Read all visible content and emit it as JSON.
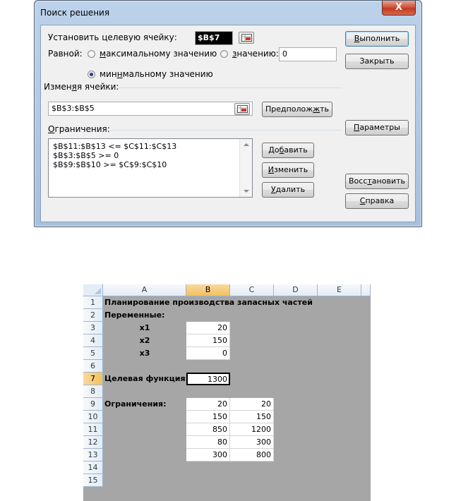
{
  "dialog": {
    "title": "Поиск решения",
    "close_glyph": "X",
    "target_label": "Установить целевую ячейку:",
    "target_value": "$B$7",
    "equal_label": "Равной:",
    "radio_max": "максимальному значению",
    "radio_value": "значению:",
    "value_input": "0",
    "radio_min": "минимальному значению",
    "changing_label": "Изменяя ячейки:",
    "changing_value": "$B$3:$B$5",
    "guess_button": "Предположить",
    "constraints_label": "Ограничения:",
    "constraints": [
      "$B$11:$B$13 <= $C$11:$C$13",
      "$B$3:$B$5 >= 0",
      "$B$9:$B$10 >= $C$9:$C$10"
    ],
    "add_button": "Добавить",
    "change_button": "Изменить",
    "delete_button": "Удалить",
    "run_button": "Выполнить",
    "close_button": "Закрыть",
    "options_button": "Параметры",
    "reset_button": "Восстановить",
    "help_button": "Справка",
    "selected_goal": "min"
  },
  "sheet": {
    "columns": [
      "A",
      "B",
      "C",
      "D",
      "E"
    ],
    "rows": [
      "1",
      "2",
      "3",
      "4",
      "5",
      "6",
      "7",
      "8",
      "9",
      "10",
      "11",
      "12",
      "13",
      "14",
      "15"
    ],
    "a1": "Планирование производства запасных частей",
    "a2": "Переменные:",
    "a3": "x1",
    "a4": "x2",
    "a5": "x3",
    "a7": "Целевая функция:",
    "a9": "Ограничения:",
    "b3": "20",
    "b4": "150",
    "b5": "0",
    "b7": "1300",
    "b9": "20",
    "c9": "20",
    "b10": "150",
    "c10": "150",
    "b11": "850",
    "c11": "1200",
    "b12": "80",
    "c12": "300",
    "b13": "300",
    "c13": "800",
    "active_cell": "B7"
  }
}
